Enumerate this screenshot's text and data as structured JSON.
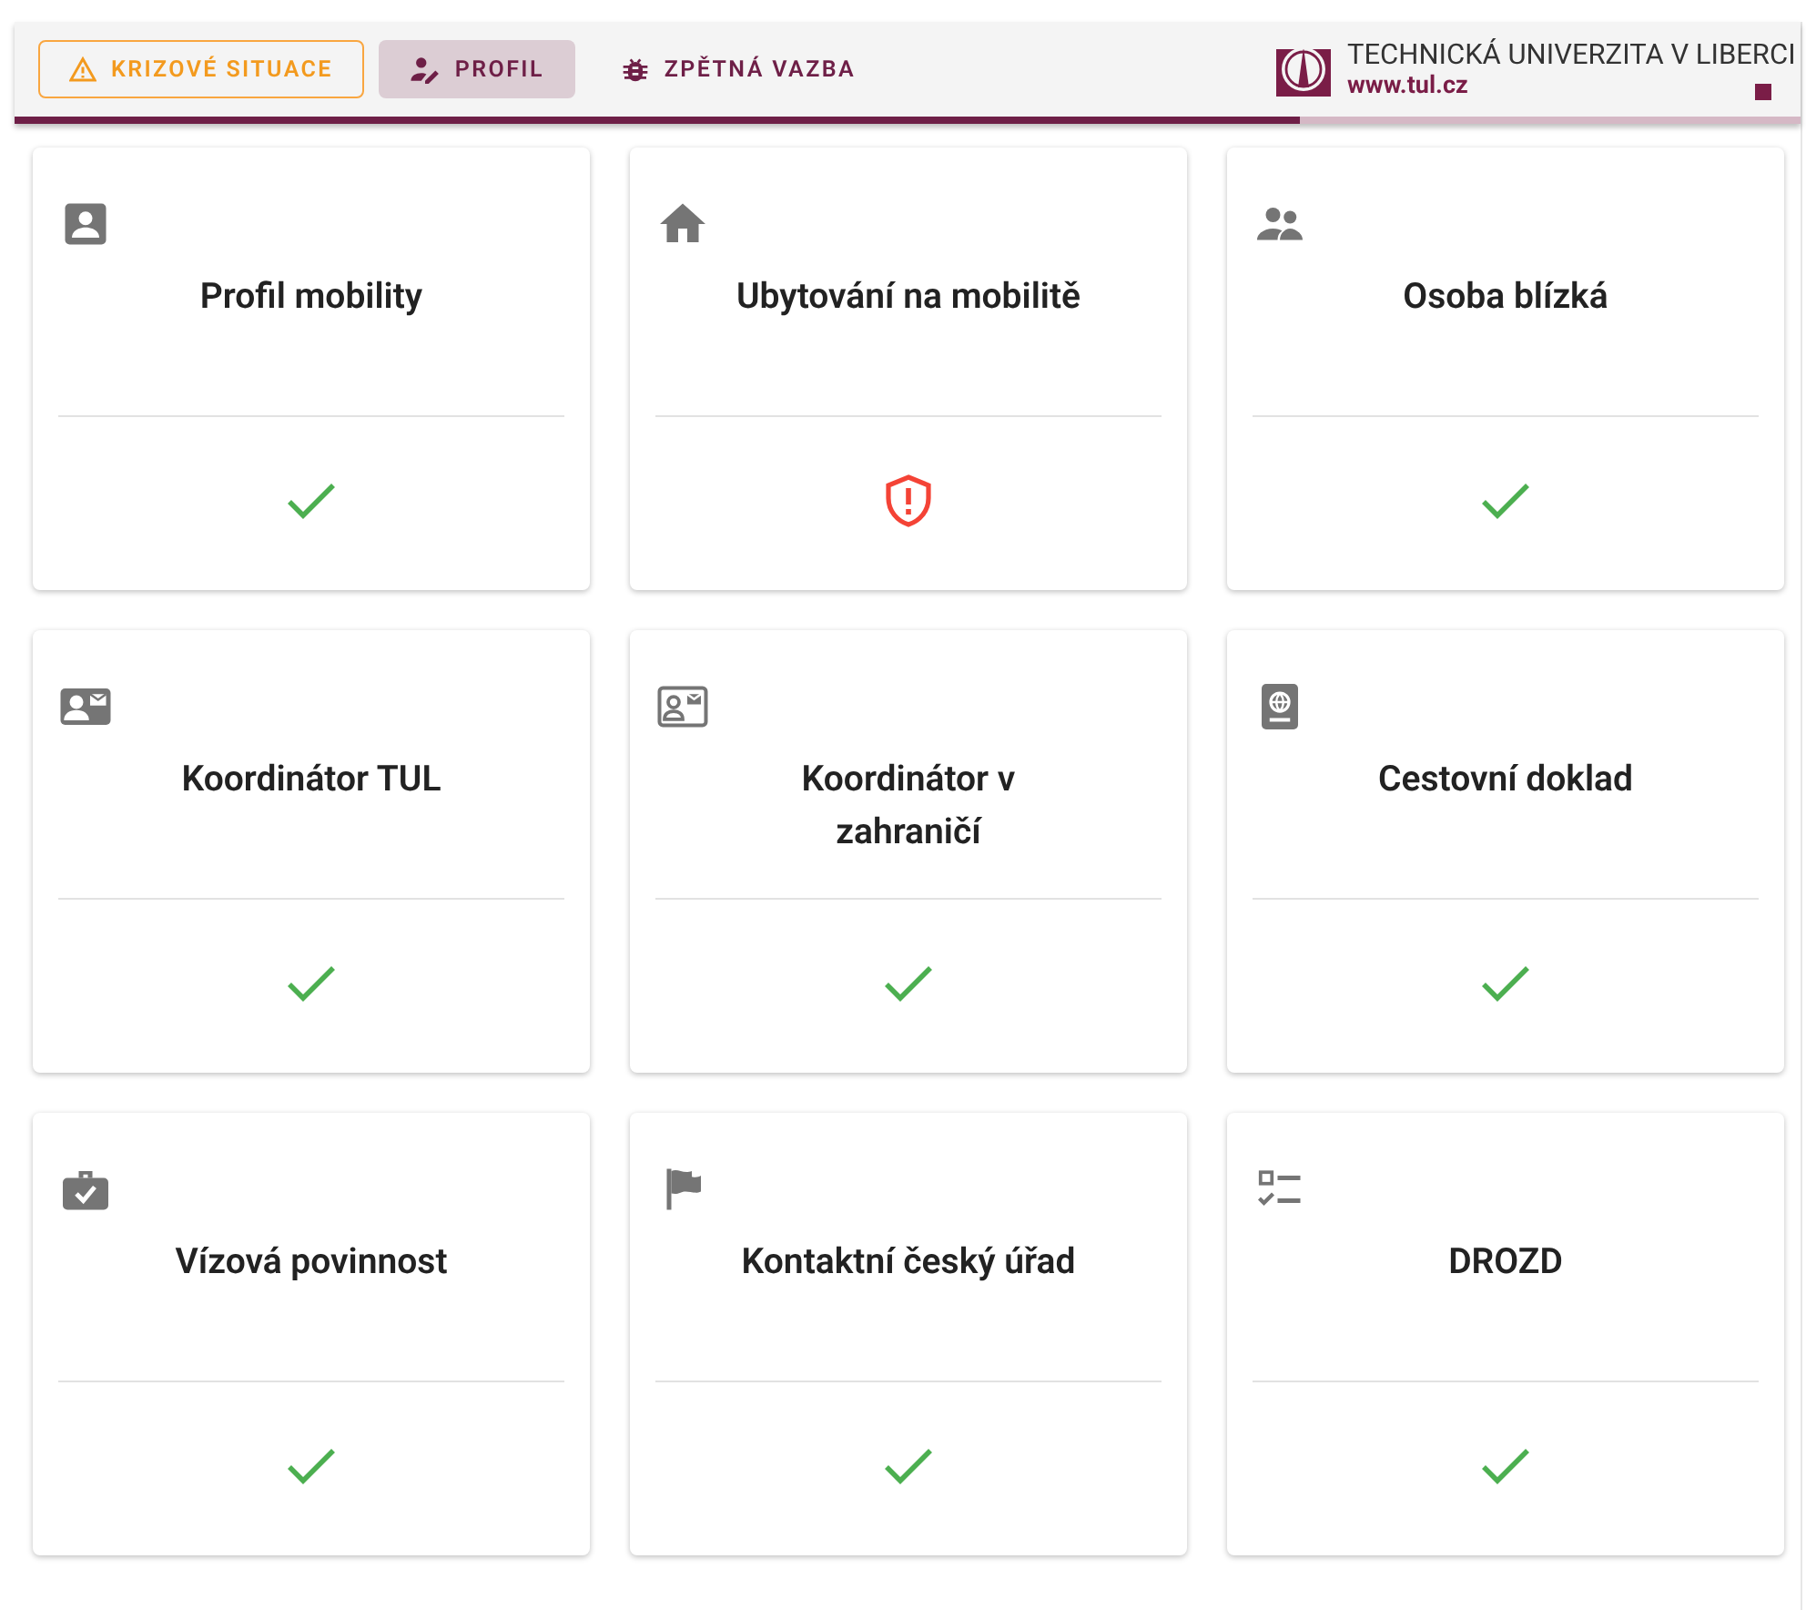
{
  "header": {
    "nav": [
      {
        "label": "KRIZOVÉ SITUACE",
        "kind": "alert",
        "selected": false
      },
      {
        "label": "PROFIL",
        "kind": "profile",
        "selected": true
      },
      {
        "label": "ZPĚTNÁ VAZBA",
        "kind": "feedback",
        "selected": false
      }
    ],
    "logo": {
      "name": "TECHNICKÁ UNIVERZITA V LIBERCI",
      "url": "www.tul.cz"
    }
  },
  "cards": [
    {
      "title": "Profil mobility",
      "complete": true
    },
    {
      "title": "Ubytování na mobilitě",
      "complete": false
    },
    {
      "title": "Osoba blízká",
      "complete": true
    },
    {
      "title": "Koordinátor TUL",
      "complete": true
    },
    {
      "title": "Koordinátor v zahraničí",
      "complete": true
    },
    {
      "title": "Cestovní doklad",
      "complete": true
    },
    {
      "title": "Vízová povinnost",
      "complete": true
    },
    {
      "title": "Kontaktní český úřad",
      "complete": true
    },
    {
      "title": "DROZD",
      "complete": true
    }
  ]
}
